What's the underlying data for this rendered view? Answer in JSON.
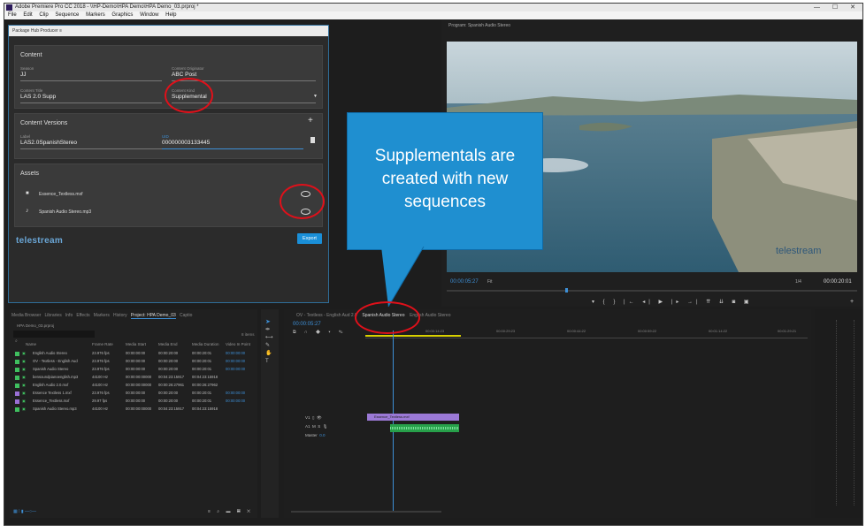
{
  "window": {
    "title": "Adobe Premiere Pro CC 2018 - \\\\HP-Demo\\HPA Demo\\HPA Demo_03.prproj *"
  },
  "menu": [
    "File",
    "Edit",
    "Clip",
    "Sequence",
    "Markers",
    "Graphics",
    "Window",
    "Help"
  ],
  "plugin": {
    "header": "Package Hub Producer",
    "content": {
      "title": "Content",
      "fields": [
        {
          "label": "Season",
          "value": "JJ"
        },
        {
          "label": "Content Originator",
          "value": "ABC Post"
        },
        {
          "label": "Content Title",
          "value": "LAS 2.0 Supp"
        },
        {
          "label": "Content Kind",
          "value": "Supplemental"
        }
      ]
    },
    "versions": {
      "title": "Content Versions",
      "label_caption": "Label",
      "label_value": "LAS2.0SpanishStereo",
      "uid_caption": "UID",
      "uid_value": "000000003133445"
    },
    "assets": {
      "title": "Assets",
      "items": [
        {
          "name": "Essence_Textless.mxf",
          "icon": "video-icon"
        },
        {
          "name": "Spanish Audio Stereo.mp3",
          "icon": "music-note-icon"
        }
      ]
    },
    "export_label": "Export",
    "logo": "telestream"
  },
  "program": {
    "title": "Program: Spanish Audio Stereo",
    "timecode": "00:00:05:27",
    "fit": "Fit",
    "ratio": "1/4",
    "duration": "00:00:20:01",
    "watermark": "telestream"
  },
  "project": {
    "tabs": [
      "Media Browser",
      "Libraries",
      "Info",
      "Effects",
      "Markers",
      "History",
      "Project: HPA Demo_03",
      "Captio"
    ],
    "bin": "HPA Demo_03.prproj",
    "count": "8 items",
    "columns": [
      "Name",
      "Frame Rate",
      "Media Start",
      "Media End",
      "Media Duration",
      "Video In Point"
    ],
    "rows": [
      {
        "name": "English Audio Stereo",
        "rate": "23.976 fps",
        "start": "00:00:00:00",
        "end": "00:00:20:00",
        "dur": "00:00:20:01",
        "vin": "00:00:00:00",
        "color": "#3fbf5f"
      },
      {
        "name": "OV - Textless - English Aud",
        "rate": "23.976 fps",
        "start": "00:00:00:00",
        "end": "00:00:20:00",
        "dur": "00:00:20:01",
        "vin": "00:00:00:00",
        "color": "#3fbf5f"
      },
      {
        "name": "Spanish Audio Stereo",
        "rate": "23.976 fps",
        "start": "00:00:00:00",
        "end": "00:00:20:00",
        "dur": "00:00:20:01",
        "vin": "00:00:00:00",
        "color": "#3fbf5f"
      },
      {
        "name": "bensoundpianoenglish.mp3",
        "rate": "44100 Hz",
        "start": "00:00:00:00000",
        "end": "00:04:23:15917",
        "dur": "00:04:23:15918",
        "vin": "",
        "color": "#3fbf5f"
      },
      {
        "name": "English Audio 2.0.mxf",
        "rate": "44100 Hz",
        "start": "00:00:00:00000",
        "end": "00:00:26:27961",
        "dur": "00:00:26:27962",
        "vin": "",
        "color": "#3fbf5f"
      },
      {
        "name": "Essence Textless 1.mxf",
        "rate": "23.976 fps",
        "start": "00:00:00:00",
        "end": "00:00:20:00",
        "dur": "00:00:20:01",
        "vin": "00:00:00:00",
        "color": "#9a6fd6"
      },
      {
        "name": "Essence_Textless.mxf",
        "rate": "29.97 fps",
        "start": "00:00:00:00",
        "end": "00:00:20:00",
        "dur": "00:00:20:01",
        "vin": "00:00:00:00",
        "color": "#9a6fd6"
      },
      {
        "name": "Spanish Audio Stereo.mp3",
        "rate": "44100 Hz",
        "start": "00:00:00:00000",
        "end": "00:04:23:15917",
        "dur": "00:04:23:15918",
        "vin": "",
        "color": "#3fbf5f"
      }
    ]
  },
  "timeline": {
    "tabs": [
      "OV - Textless - English Aud 2.0",
      "Spanish Audio Stereo",
      "English Audio Stereo"
    ],
    "timecode": "00:00:05:27",
    "ruler": [
      "00:00:14:23",
      "00:00:29:23",
      "00:00:44:22",
      "00:00:59:22",
      "00:01:14:22",
      "00:01:29:21"
    ],
    "video_clip": "Essence_Textless.mxf",
    "master": "Master",
    "master_val": "0.0"
  },
  "callout": {
    "text": [
      "Supplementals are",
      "created with new",
      "sequences"
    ]
  },
  "colors": {
    "accent": "#1f8fd0",
    "highlight": "#e0101a",
    "timecode": "#3d8fd6"
  }
}
